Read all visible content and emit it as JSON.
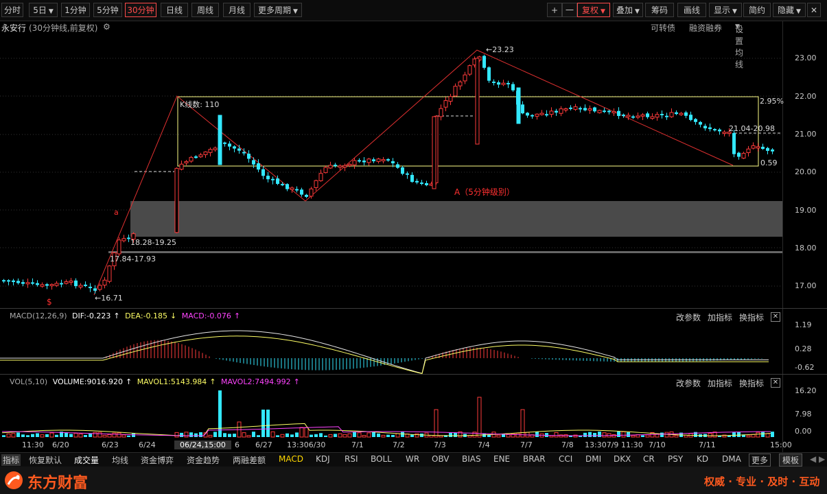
{
  "toolbar": {
    "periods": [
      "分时",
      "5日",
      "1分钟",
      "5分钟",
      "30分钟",
      "日线",
      "周线",
      "月线",
      "更多周期"
    ],
    "active_period": "30分钟",
    "right_buttons": [
      "+",
      "一",
      "复权",
      "叠加",
      "筹码",
      "画线",
      "显示",
      "简约",
      "隐藏"
    ]
  },
  "title": {
    "stock_name": "永安行",
    "chart_desc": "(30分钟线,前复权)",
    "links": [
      "可转债",
      "融资融券",
      "设置均线"
    ]
  },
  "price_axis": [
    "23.00",
    "22.00",
    "21.00",
    "20.00",
    "19.00",
    "18.00",
    "17.00"
  ],
  "annotations": {
    "high": "23.23",
    "low": "16.71",
    "kline_count": "K线数: 110",
    "pct_top": "2.95%",
    "diff_bottom": "0.59",
    "range_label": "21.04-20.98",
    "zone1": "18.28-19.25",
    "zone2": "17.84-17.93",
    "wave_note": "A（5分钟级别）",
    "mark_a": "a",
    "mark_s": "$"
  },
  "macd": {
    "label": "MACD(12,26,9)",
    "dif": "DIF:-0.223",
    "dea": "DEA:-0.185",
    "macd": "MACD:-0.076",
    "axis": [
      "1.19",
      "0.28",
      "-0.62"
    ]
  },
  "vol": {
    "label": "VOL(5,10)",
    "volume": "VOLUME:9016.920",
    "mavol1": "MAVOL1:5143.984",
    "mavol2": "MAVOL2:7494.992",
    "axis": [
      "16.20",
      "7.98",
      "0.00"
    ]
  },
  "indicator_buttons": [
    "改参数",
    "加指标",
    "换指标"
  ],
  "time_axis": [
    "11:30",
    "6/20",
    "6/23",
    "6/24",
    "06/24,15:00",
    "6",
    "6/27",
    "13:306/30",
    "7/1",
    "7/2",
    "7/3",
    "7/4",
    "7/7",
    "7/8",
    "13:307/9",
    "11:30",
    "7/10",
    "7/11",
    "15:00"
  ],
  "indicator_tabs": [
    "指标",
    "恢复默认",
    "成交量",
    "均线",
    "资金博弈",
    "资金趋势",
    "两融差额",
    "MACD",
    "KDJ",
    "RSI",
    "BOLL",
    "WR",
    "OBV",
    "BIAS",
    "ENE",
    "BRAR",
    "CCI",
    "DMI",
    "DKX",
    "CR",
    "PSY",
    "KD",
    "DMA",
    "更多",
    "模板"
  ],
  "active_tab": "MACD",
  "footer": {
    "brand": "东方财富",
    "slogan": "权威 · 专业 · 及时 · 互动"
  },
  "colors": {
    "up": "#ff3b3b",
    "down": "#33e8ff",
    "yellow": "#ffff66",
    "magenta": "#ff44ff"
  }
}
